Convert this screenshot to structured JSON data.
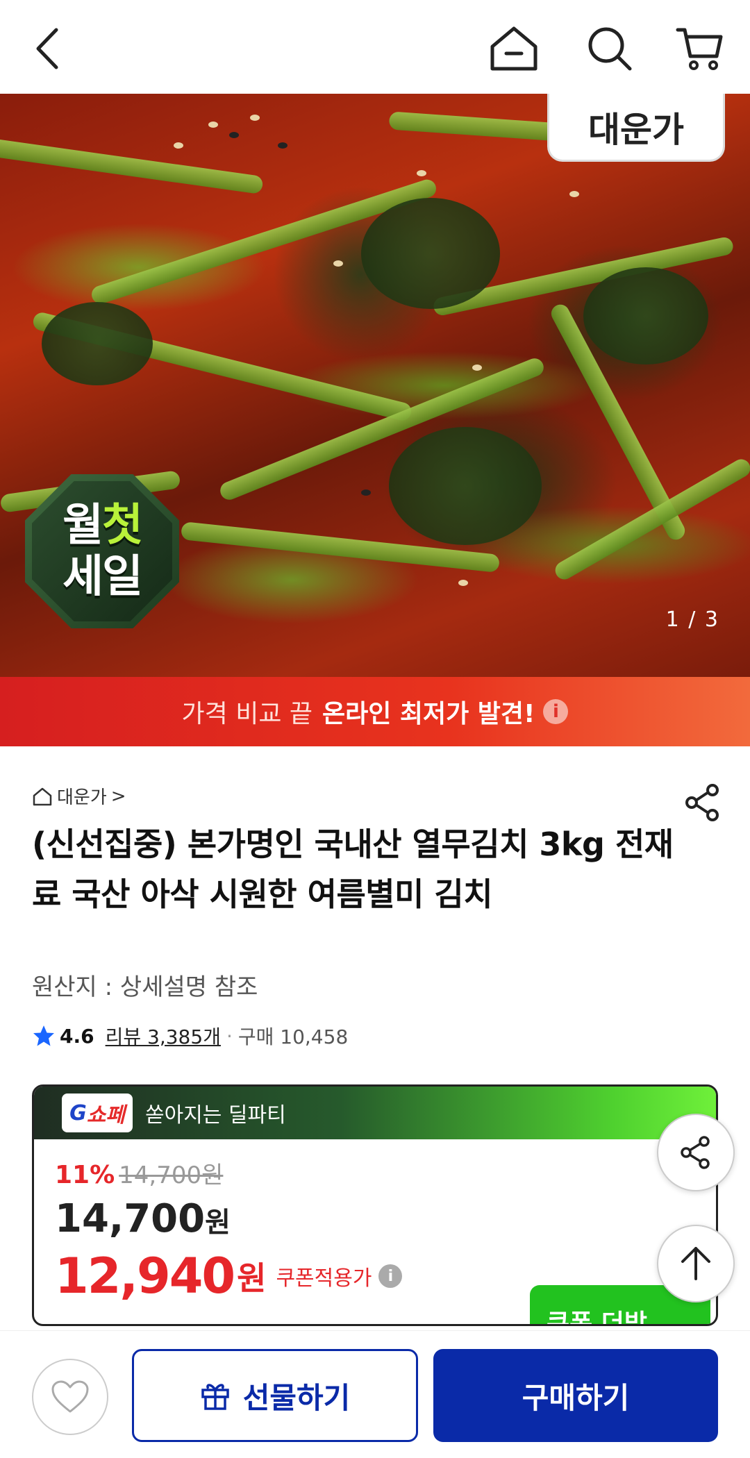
{
  "header": {
    "icons": [
      "back-arrow-icon",
      "home-icon",
      "search-icon",
      "cart-icon"
    ]
  },
  "hero": {
    "brand_badge": "대운가",
    "sale_badge_line1_a": "월",
    "sale_badge_line1_b": "첫",
    "sale_badge_line2": "세일",
    "counter": "1 / 3"
  },
  "banner": {
    "text_light": "가격 비교 끝",
    "text_bold": "온라인 최저가 발견!",
    "info_glyph": "i"
  },
  "product": {
    "store_name": "대운가",
    "store_chevron": ">",
    "title": "(신선집중) 본가명인 국내산 열무김치 3kg 전재료 국산 아삭 시원한 여름별미 김치",
    "origin": "원산지 : 상세설명 참조",
    "rating": "4.6",
    "reviews": "리뷰 3,385개",
    "dot": "·",
    "purchases": "구매 10,458"
  },
  "deal": {
    "logo_g": "G",
    "logo_rest": "쇼페",
    "tagline": "쏟아지는 딜파티",
    "discount": "11%",
    "original_price": "14,700원",
    "price": "14,700",
    "price_unit": "원",
    "sale_price": "12,940",
    "sale_unit": "원",
    "sale_label": "쿠폰적용가",
    "info_glyph": "i",
    "coupon_button": "쿠폰 더받"
  },
  "bottom_bar": {
    "gift_button": "선물하기",
    "buy_button": "구매하기"
  },
  "colors": {
    "accent_red": "#e6262a",
    "brand_blue": "#0a2aa8",
    "deal_green": "#22c21f"
  }
}
